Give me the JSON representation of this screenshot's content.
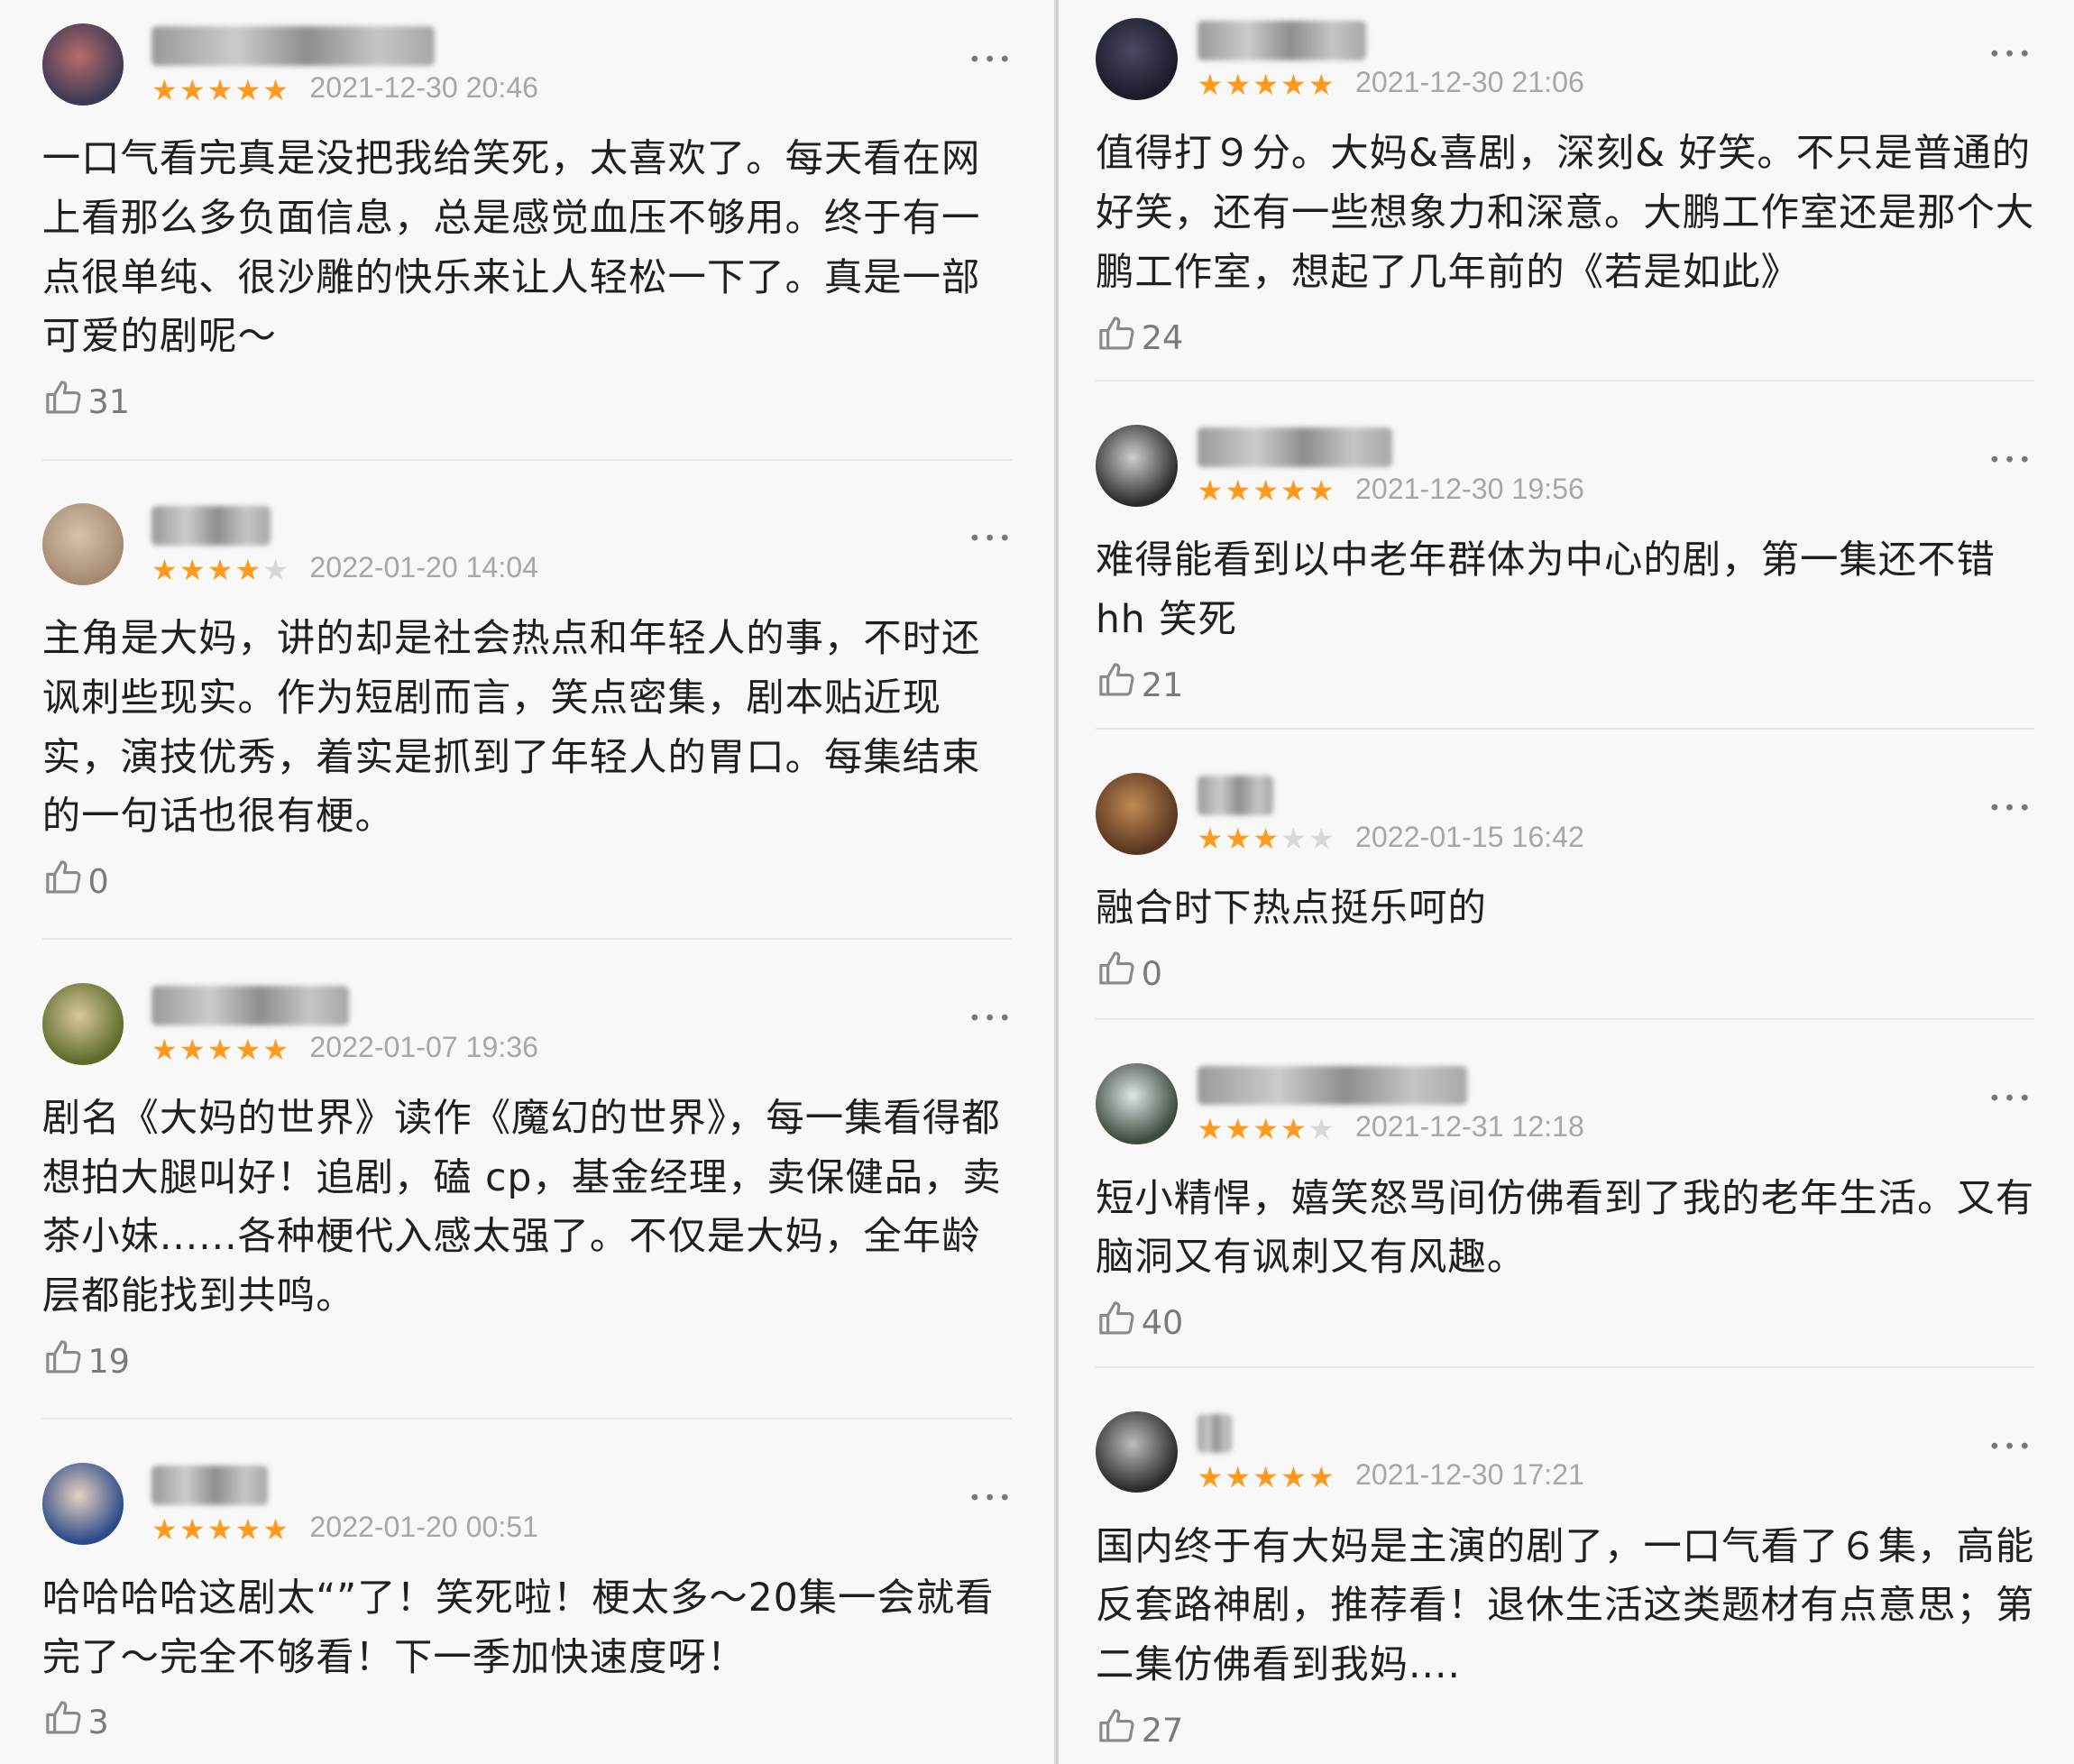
{
  "left": [
    {
      "user": "哈哈哈哈哈螃蟹啦",
      "stars": 5,
      "time": "2021-12-30 20:46",
      "text": "一口气看完真是没把我给笑死，太喜欢了。每天看在网上看那么多负面信息，总是感觉血压不够用。终于有一点很单纯、很沙雕的快乐来让人轻松一下了。真是一部可爱的剧呢～",
      "likes": "31",
      "avatar_colors": [
        "#3a3a55",
        "#b86b6b"
      ]
    },
    {
      "user": "羊驼话",
      "stars": 4,
      "time": "2022-01-20 14:04",
      "text": "主角是大妈，讲的却是社会热点和年轻人的事，不时还讽刺些现实。作为短剧而言，笑点密集，剧本贴近现实，演技优秀，着实是抓到了年轻人的胃口。每集结束的一句话也很有梗。",
      "likes": "0",
      "avatar_colors": [
        "#a58a72",
        "#d7c3ad"
      ]
    },
    {
      "user": "找说的都对",
      "stars": 5,
      "time": "2022-01-07 19:36",
      "text": "剧名《大妈的世界》读作《魔幻的世界》，每一集看得都想拍大腿叫好！追剧，磕 cp，基金经理，卖保健品，卖茶小妹......各种梗代入感太强了。不仅是大妈，全年龄层都能找到共鸣。",
      "likes": "19",
      "avatar_colors": [
        "#5d6b2a",
        "#d9c99a"
      ]
    },
    {
      "user": "mgor3",
      "stars": 5,
      "time": "2022-01-20 00:51",
      "text": "哈哈哈哈这剧太“”了！笑死啦！梗太多～20集一会就看完了～完全不够看！下一季加快速度呀！",
      "likes": "3",
      "avatar_colors": [
        "#2b4a8a",
        "#e8d2c0"
      ]
    }
  ],
  "right": [
    {
      "user": "kinshean",
      "stars": 5,
      "time": "2021-12-30 21:06",
      "text": "值得打９分。大妈&喜剧，深刻& 好笑。不只是普通的好笑，还有一些想象力和深意。大鹏工作室还是那个大鹏工作室，想起了几年前的《若是如此》",
      "likes": "24",
      "avatar_colors": [
        "#1a1a28",
        "#4a4a66"
      ]
    },
    {
      "user": "陈豆子丰田",
      "stars": 5,
      "time": "2021-12-30 19:56",
      "text": "难得能看到以中老年群体为中心的剧，第一集还不错 hh 笑死",
      "likes": "21",
      "avatar_colors": [
        "#2a2a2a",
        "#cfcfcf"
      ]
    },
    {
      "user": "轩草",
      "stars": 3,
      "time": "2022-01-15 16:42",
      "text": "融合时下热点挺乐呵的",
      "likes": "0",
      "avatar_colors": [
        "#5a3520",
        "#c08a55"
      ]
    },
    {
      "user": "我要变成猪猪子",
      "stars": 4,
      "time": "2021-12-31 12:18",
      "text": "短小精悍，嬉笑怒骂间仿佛看到了我的老年生活。又有脑洞又有讽刺又有风趣。",
      "likes": "40",
      "avatar_colors": [
        "#3b4a3b",
        "#dfe5e8"
      ]
    },
    {
      "user": "w",
      "stars": 5,
      "time": "2021-12-30 17:21",
      "text": "国内终于有大妈是主演的剧了，一口气看了６集，高能反套路神剧，推荐看！退休生活这类题材有点意思；第二集仿佛看到我妈....",
      "likes": "27",
      "avatar_colors": [
        "#2a2a2a",
        "#bdbdbd"
      ]
    }
  ],
  "more_glyph": "•••",
  "star_glyph": "★"
}
